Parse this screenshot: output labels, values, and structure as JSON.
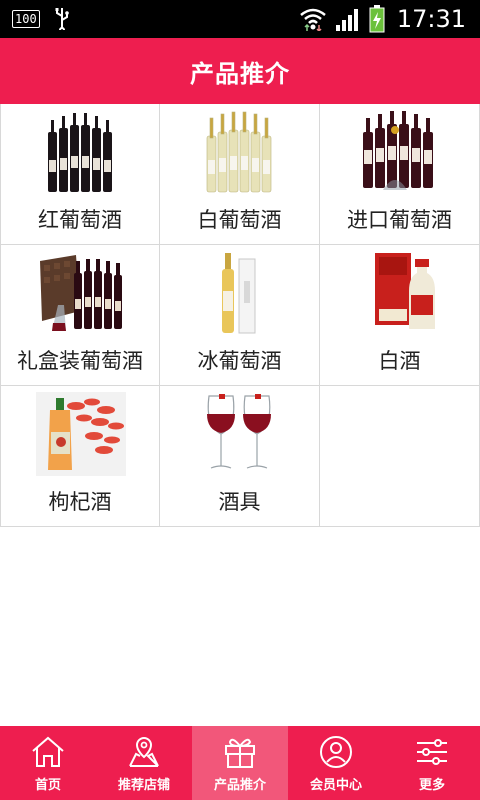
{
  "status_bar": {
    "battery_badge": "100",
    "time": "17:31",
    "icons": [
      "usb-icon",
      "wifi-icon",
      "signal-icon",
      "battery-charging-icon"
    ]
  },
  "header": {
    "title": "产品推介"
  },
  "colors": {
    "brand": "#ee1e4f",
    "active_tab": "#f2577a"
  },
  "products": [
    {
      "label": "红葡萄酒",
      "icon": "red-wine-bottles"
    },
    {
      "label": "白葡萄酒",
      "icon": "white-wine-bottles"
    },
    {
      "label": "进口葡萄酒",
      "icon": "imported-wine-bottles"
    },
    {
      "label": "礼盒装葡萄酒",
      "icon": "gift-box-wine"
    },
    {
      "label": "冰葡萄酒",
      "icon": "ice-wine-bottle"
    },
    {
      "label": "白酒",
      "icon": "baijiu-bottle"
    },
    {
      "label": "枸杞酒",
      "icon": "goji-wine"
    },
    {
      "label": "酒具",
      "icon": "wine-glasses"
    }
  ],
  "bottom_nav": {
    "items": [
      {
        "label": "首页",
        "icon": "home-icon"
      },
      {
        "label": "推荐店铺",
        "icon": "map-pin-icon"
      },
      {
        "label": "产品推介",
        "icon": "gift-icon"
      },
      {
        "label": "会员中心",
        "icon": "user-circle-icon"
      },
      {
        "label": "更多",
        "icon": "sliders-icon"
      }
    ],
    "active": "产品推介"
  }
}
